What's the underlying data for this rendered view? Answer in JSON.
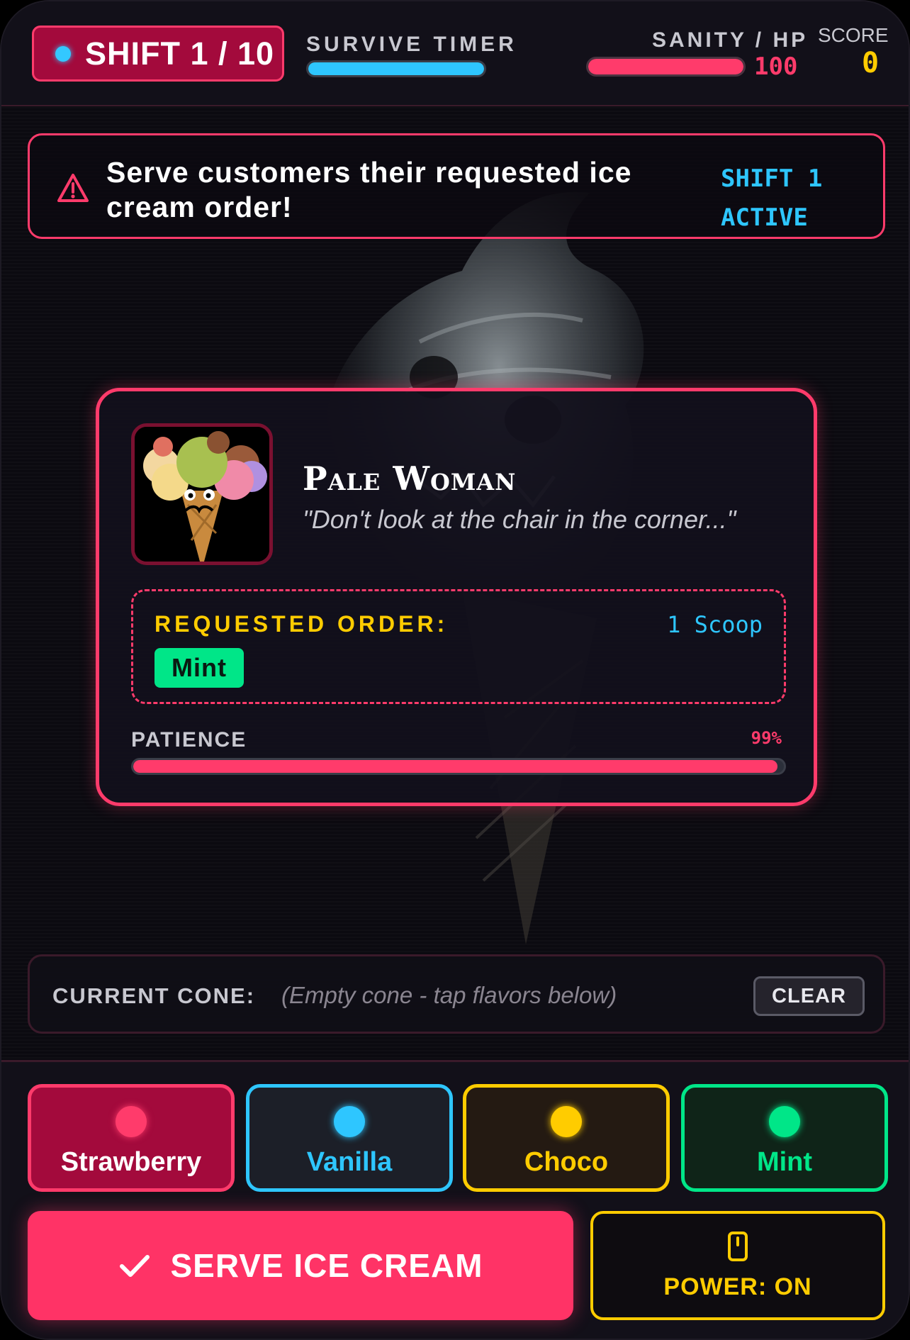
{
  "hud": {
    "shift_label": "SHIFT 1 / 10",
    "timer_label": "SURVIVE TIMER",
    "timer_fraction": 1.0,
    "hp_label": "SANITY / HP",
    "hp_fraction": 1.0,
    "hp_value": "100",
    "score_label": "SCORE",
    "score_value": "0"
  },
  "alert": {
    "message": "Serve customers their requested ice cream order!",
    "status_line1": "SHIFT 1",
    "status_line2": "ACTIVE"
  },
  "customer": {
    "name": "Pale Woman",
    "quote": "\"Don't look at the chair in the corner...\"",
    "order_label": "REQUESTED ORDER:",
    "order_count": "1 Scoop",
    "order_flavor": "Mint",
    "patience_label": "PATIENCE",
    "patience_value": "99%",
    "patience_fraction": 0.99
  },
  "cone": {
    "label": "CURRENT CONE:",
    "value": "(Empty cone - tap flavors below)",
    "clear_label": "CLEAR"
  },
  "flavors": [
    {
      "label": "Strawberry",
      "color": "#ff3b6b"
    },
    {
      "label": "Vanilla",
      "color": "#2ec6ff"
    },
    {
      "label": "Choco",
      "color": "#ffcc00"
    },
    {
      "label": "Mint",
      "color": "#00e688"
    }
  ],
  "actions": {
    "serve_label": "SERVE ICE CREAM",
    "serve_icon": "check-icon",
    "power_label": "POWER: ON",
    "power_icon": "phone-icon"
  },
  "colors": {
    "accent": "#ff3b6b",
    "cyan": "#2ec6ff",
    "yellow": "#ffcc00",
    "green": "#00e688"
  }
}
